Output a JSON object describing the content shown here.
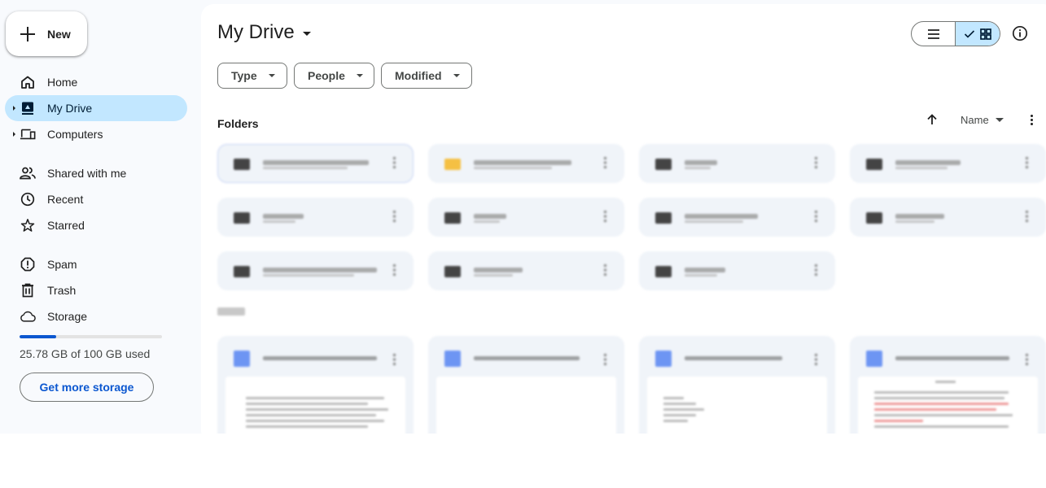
{
  "sidebar": {
    "new_label": "New",
    "items": [
      {
        "label": "Home",
        "icon": "home-icon"
      },
      {
        "label": "My Drive",
        "icon": "my-drive-icon",
        "active": true,
        "expandable": true
      },
      {
        "label": "Computers",
        "icon": "computers-icon",
        "expandable": true
      },
      {
        "label": "Shared with me",
        "icon": "shared-icon"
      },
      {
        "label": "Recent",
        "icon": "clock-icon"
      },
      {
        "label": "Starred",
        "icon": "star-icon"
      },
      {
        "label": "Spam",
        "icon": "spam-icon"
      },
      {
        "label": "Trash",
        "icon": "trash-icon"
      },
      {
        "label": "Storage",
        "icon": "cloud-icon"
      }
    ],
    "storage": {
      "used_fraction": 0.2578,
      "text": "25.78 GB of 100 GB used",
      "button_label": "Get more storage"
    }
  },
  "main": {
    "title": "My Drive",
    "filters": [
      {
        "label": "Type"
      },
      {
        "label": "People"
      },
      {
        "label": "Modified"
      }
    ],
    "view": {
      "mode": "grid",
      "options": [
        "list",
        "grid"
      ]
    },
    "folders_label": "Folders",
    "sort": {
      "label": "Name",
      "direction": "ascending"
    },
    "folders": [
      {
        "color": "dark",
        "selected": true
      },
      {
        "color": "yellow"
      },
      {
        "color": "dark"
      },
      {
        "color": "dark"
      },
      {
        "color": "dark"
      },
      {
        "color": "dark"
      },
      {
        "color": "dark"
      },
      {
        "color": "dark"
      },
      {
        "color": "dark"
      },
      {
        "color": "dark"
      },
      {
        "color": "dark"
      }
    ],
    "files": [
      {
        "type": "document"
      },
      {
        "type": "document"
      },
      {
        "type": "document"
      },
      {
        "type": "document"
      }
    ]
  },
  "colors": {
    "accent": "#0b57d0",
    "active_nav": "#c2e7ff",
    "card_bg": "#f0f4f9",
    "app_bg": "#f8fafd"
  }
}
